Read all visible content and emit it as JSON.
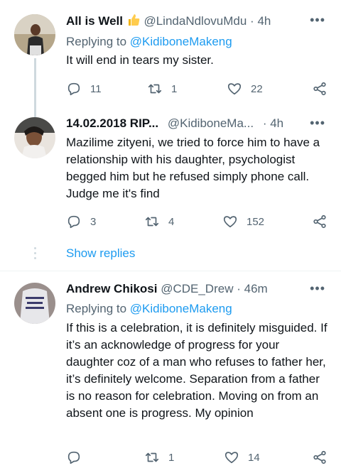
{
  "tweets": [
    {
      "name": "All is Well",
      "handle": "@LindaNdlovuMdu",
      "time": "4h",
      "replying_label": "Replying to",
      "replying_to": "@KidiboneMakeng",
      "text": "It will end in tears my sister.",
      "replies": "11",
      "retweets": "1",
      "likes": "22"
    },
    {
      "name": "14.02.2018 RIP...",
      "handle": "@KidiboneMa...",
      "time": "4h",
      "text": "Mazilime zityeni, we tried to force him to have a relationship with his daughter, psychologist begged him but he refused simply phone call. Judge me it's find",
      "replies": "3",
      "retweets": "4",
      "likes": "152"
    },
    {
      "name": "Andrew Chikosi",
      "handle": "@CDE_Drew",
      "time": "46m",
      "replying_label": "Replying to",
      "replying_to": "@KidiboneMakeng",
      "text": "If this is a celebration, it is definitely misguided. If it’s an acknowledge of progress for your daughter coz of a man who refuses to father her, it’s definitely welcome. Separation from a father is no reason for celebration. Moving on from an absent one is progress. My opinion",
      "retweets": "1",
      "likes": "14"
    }
  ],
  "show_replies": "Show replies",
  "separator": "·",
  "more": "•••",
  "colors": {
    "link": "#1d9bf0",
    "muted": "#536471",
    "text": "#0f1419",
    "thread_line": "#cfd9de"
  }
}
